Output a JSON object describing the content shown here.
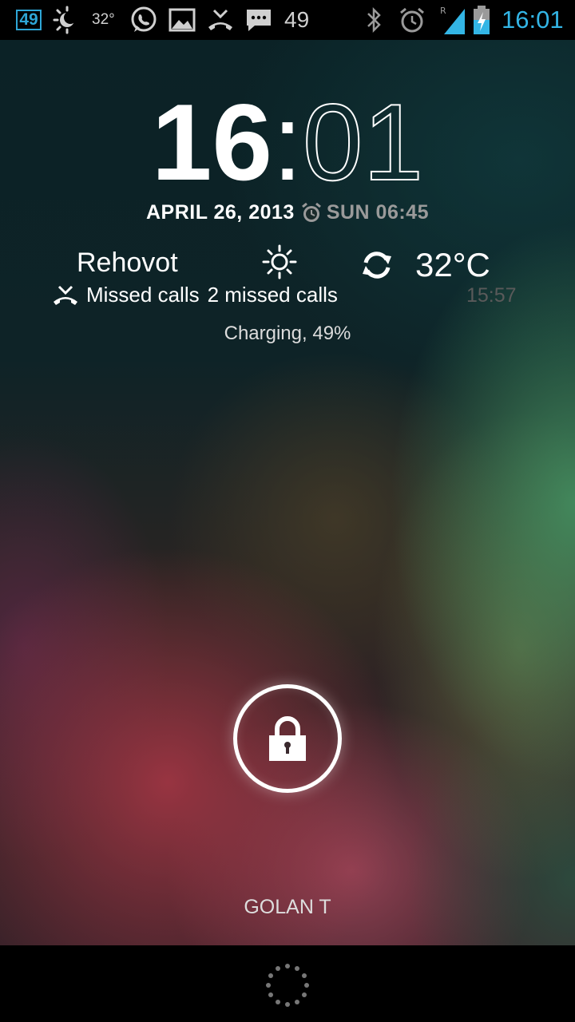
{
  "status_bar": {
    "badge": "49",
    "weather_temp": "32°",
    "notification_count": "49",
    "time": "16:01",
    "icons": [
      "badge-49",
      "weather-icon",
      "whatsapp-icon",
      "gallery-icon",
      "missed-call-icon",
      "message-icon",
      "bluetooth-icon",
      "alarm-icon",
      "signal-icon",
      "battery-charging-icon"
    ],
    "accent_color": "#33b5e5"
  },
  "clock": {
    "hours": "16",
    "separator": ":",
    "minutes": "01"
  },
  "date": {
    "text": "APRIL 26, 2013",
    "alarm": "SUN 06:45"
  },
  "weather": {
    "city": "Rehovot",
    "condition_icon": "sun-icon",
    "temperature": "32°C",
    "updated": "15:57"
  },
  "missed_calls": {
    "label": "Missed calls",
    "detail": "2 missed calls"
  },
  "charging": "Charging, 49%",
  "owner": "GOLAN T",
  "lock_icon": "lock-icon"
}
